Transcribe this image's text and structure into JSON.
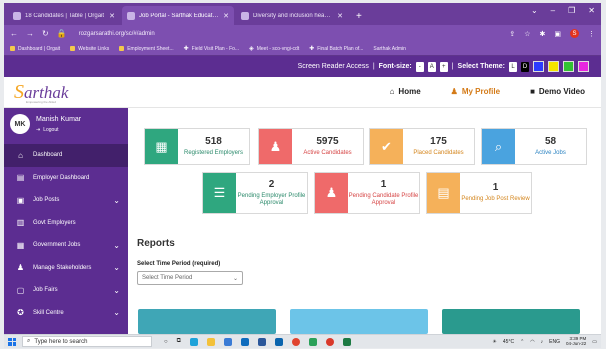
{
  "browser": {
    "tabs": [
      {
        "title": "18 Candidates | Table | Orgait",
        "active": false
      },
      {
        "title": "Job Portal - Sarthak Educational",
        "active": true
      },
      {
        "title": "Diversity and inclusion head/po",
        "active": false
      }
    ],
    "url": "rozgarsarathi.org/sc/#/admin",
    "bookmarks": [
      "Dashboard | Orgait",
      "Website Links",
      "Employment Sheet...",
      "Field Visit Plan - Fo...",
      "Meet - sco-vngi-cdt",
      "Final Batch Plan of...",
      "Sarthak Admin"
    ],
    "profile_initial": "S"
  },
  "accessbar": {
    "screen_reader": "Screen Reader Access",
    "font_size_label": "Font-size:",
    "font_buttons": [
      "-",
      "A",
      "+"
    ],
    "theme_label": "Select Theme:",
    "theme_buttons": [
      "L",
      "D"
    ],
    "theme_colors": [
      "#ffffff",
      "#000000",
      "#2b3aff",
      "#f4e400",
      "#33c233",
      "#e825e0"
    ]
  },
  "header": {
    "logo_text": "arthak",
    "logo_s": "S",
    "logo_tagline": "Empowering the Abled",
    "nav": [
      {
        "label": "Home",
        "icon": "home-icon"
      },
      {
        "label": "My Profile",
        "icon": "user-icon"
      },
      {
        "label": "Demo Video",
        "icon": "video-icon"
      }
    ]
  },
  "sidebar": {
    "avatar": "MK",
    "user_name": "Manish Kumar",
    "logout": "Logout",
    "items": [
      {
        "label": "Dashboard",
        "icon": "dashboard-icon",
        "active": true,
        "chevron": false
      },
      {
        "label": "Employer Dashboard",
        "icon": "chart-icon",
        "active": false,
        "chevron": false
      },
      {
        "label": "Job Posts",
        "icon": "briefcase-icon",
        "active": false,
        "chevron": true
      },
      {
        "label": "Govt Employers",
        "icon": "building-icon",
        "active": false,
        "chevron": false
      },
      {
        "label": "Government Jobs",
        "icon": "bank-icon",
        "active": false,
        "chevron": true
      },
      {
        "label": "Manage Stakeholders",
        "icon": "users-icon",
        "active": false,
        "chevron": true
      },
      {
        "label": "Job Fairs",
        "icon": "calendar-icon",
        "active": false,
        "chevron": true
      },
      {
        "label": "Skill Centre",
        "icon": "graduation-icon",
        "active": false,
        "chevron": true
      }
    ]
  },
  "stats": [
    {
      "value": "518",
      "label": "Registered Employers",
      "color": "#2fa77f",
      "text_color": "#2b8a6b",
      "icon": "employer-icon"
    },
    {
      "value": "5975",
      "label": "Active Candidates",
      "color": "#ef6a6a",
      "text_color": "#d64545",
      "icon": "candidates-icon"
    },
    {
      "value": "175",
      "label": "Placed Candidates",
      "color": "#f5b15a",
      "text_color": "#d4861e",
      "icon": "placed-icon"
    },
    {
      "value": "58",
      "label": "Active Jobs",
      "color": "#4aa3df",
      "text_color": "#2d84c2",
      "icon": "search-jobs-icon"
    },
    {
      "value": "2",
      "label": "Pending Employer Profile Approval",
      "color": "#2fa77f",
      "text_color": "#2b8a6b",
      "icon": "document-icon"
    },
    {
      "value": "1",
      "label": "Pending Candidate Profile Approval",
      "color": "#ef6a6a",
      "text_color": "#d64545",
      "icon": "candidate-pending-icon"
    },
    {
      "value": "1",
      "label": "Pending Job Post Review",
      "color": "#f5b15a",
      "text_color": "#d4861e",
      "icon": "job-review-icon"
    }
  ],
  "reports": {
    "title": "Reports",
    "period_label": "Select Time Period (required)",
    "period_placeholder": "Select Time Period"
  },
  "taskbar": {
    "search_placeholder": "Type here to search",
    "weather": "45°C",
    "lang": "ENG",
    "time": "3:39 PM",
    "date": "04-Jun-22"
  }
}
